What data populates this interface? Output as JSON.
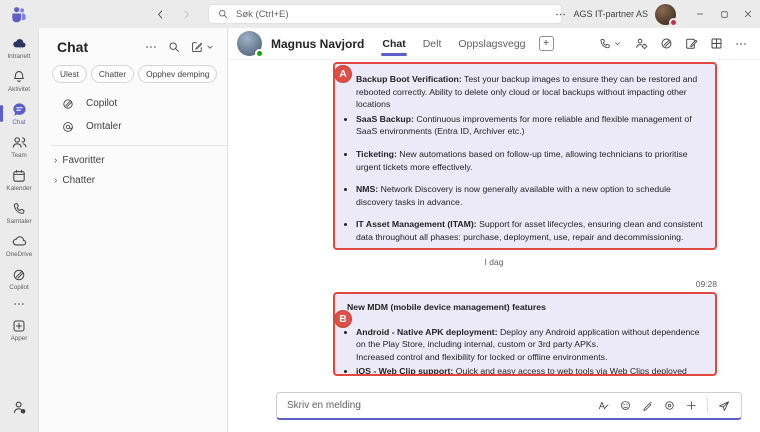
{
  "titlebar": {
    "search_placeholder": "Søk (Ctrl+E)",
    "org_name": "AGS IT-partner AS"
  },
  "rail": {
    "items": [
      {
        "label": "Intranett"
      },
      {
        "label": "Aktivitet"
      },
      {
        "label": "Chat"
      },
      {
        "label": "Team"
      },
      {
        "label": "Kalender"
      },
      {
        "label": "Samtaler"
      },
      {
        "label": "OneDrive"
      },
      {
        "label": "Copilot"
      },
      {
        "label": "Apper"
      }
    ]
  },
  "chat_panel": {
    "title": "Chat",
    "filters": [
      "Ulest",
      "Chatter",
      "Opphev demping"
    ],
    "items": [
      {
        "label": "Copilot"
      },
      {
        "label": "Omtaler"
      }
    ],
    "groups": [
      {
        "label": "Favoritter"
      },
      {
        "label": "Chatter"
      }
    ]
  },
  "conversation": {
    "name": "Magnus Navjord",
    "tabs": [
      {
        "label": "Chat"
      },
      {
        "label": "Delt"
      },
      {
        "label": "Oppslagsvegg"
      }
    ],
    "date_divider": "I dag",
    "messages": [
      {
        "annotation": "A",
        "bullets": [
          {
            "bold": "Backup Boot Verification:",
            "text": " Test your backup images to ensure they can be restored and rebooted correctly. Ability to delete only cloud or local backups without impacting other locations"
          },
          {
            "bold": "SaaS Backup:",
            "text": " Continuous improvements for more reliable and flexible management of SaaS environments (Entra ID, Archiver etc.)"
          },
          {
            "bold": "Ticketing:",
            "text": " New automations based on follow-up time, allowing technicians to prioritise urgent tickets more effectively."
          },
          {
            "bold": "NMS:",
            "text": " Network Discovery is now generally available with a new option to schedule discovery tasks in advance."
          },
          {
            "bold": "IT Asset Management (ITAM):",
            "text": " Support for asset lifecycles, ensuring clean and consistent data throughout all phases: purchase, deployment, use, repair and decommissioning."
          }
        ]
      },
      {
        "annotation": "B",
        "timestamp": "09:28",
        "title": "New MDM (mobile device management) features",
        "bullets": [
          {
            "bold": "Android - Native APK deployment:",
            "text": " Deploy any Android application without dependence on the Play Store, including internal, custom or 3rd party APKs.\nIncreased control and flexibility for locked or offline environments."
          },
          {
            "bold": "iOS - Web Clip support:",
            "text": " Quick and easy access to web tools via Web Clips deployed directly"
          }
        ]
      }
    ]
  },
  "compose": {
    "placeholder": "Skriv en melding"
  },
  "colors": {
    "accent": "#5B5FC7",
    "annotation_red": "#E1493F",
    "bubble": "#ECE9F8",
    "chrome_gray": "#EBEBEB"
  }
}
